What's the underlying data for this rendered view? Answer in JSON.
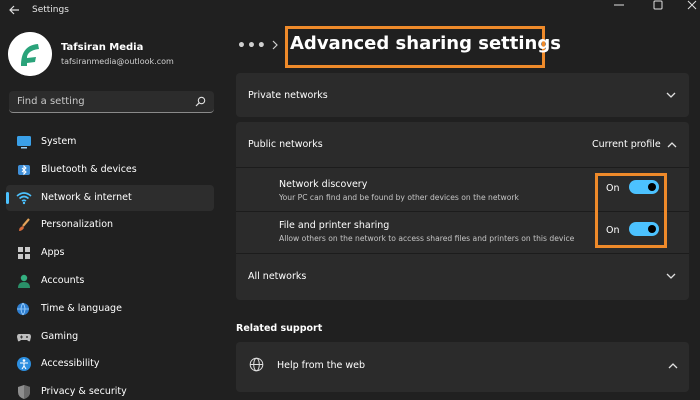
{
  "titlebar": {
    "app_title": "Settings"
  },
  "profile": {
    "name": "Tafsiran Media",
    "email": "tafsiranmedia@outlook.com"
  },
  "search": {
    "placeholder": "Find a setting"
  },
  "sidebar": {
    "items": [
      {
        "label": "System",
        "icon": "monitor-icon",
        "active": false
      },
      {
        "label": "Bluetooth & devices",
        "icon": "bluetooth-icon",
        "active": false
      },
      {
        "label": "Network & internet",
        "icon": "wifi-icon",
        "active": true
      },
      {
        "label": "Personalization",
        "icon": "brush-icon",
        "active": false
      },
      {
        "label": "Apps",
        "icon": "apps-icon",
        "active": false
      },
      {
        "label": "Accounts",
        "icon": "person-icon",
        "active": false
      },
      {
        "label": "Time & language",
        "icon": "globe-clock-icon",
        "active": false
      },
      {
        "label": "Gaming",
        "icon": "gamepad-icon",
        "active": false
      },
      {
        "label": "Accessibility",
        "icon": "accessibility-icon",
        "active": false
      },
      {
        "label": "Privacy & security",
        "icon": "shield-icon",
        "active": false
      }
    ]
  },
  "breadcrumb": {
    "ellipsis": "•••",
    "title": "Advanced sharing settings"
  },
  "sections": {
    "private": {
      "label": "Private networks",
      "expanded": false
    },
    "public": {
      "label": "Public networks",
      "tag": "Current profile",
      "expanded": true,
      "settings": [
        {
          "title": "Network discovery",
          "description": "Your PC can find and be found by other devices on the network",
          "state": "On"
        },
        {
          "title": "File and printer sharing",
          "description": "Allow others on the network to access shared files and printers on this device",
          "state": "On"
        }
      ]
    },
    "all": {
      "label": "All networks",
      "expanded": false
    }
  },
  "related_support": {
    "heading": "Related support",
    "help": {
      "label": "Help from the web",
      "expanded": true
    }
  },
  "colors": {
    "accent": "#4cc2ff",
    "highlight": "#ef8a2a",
    "background": "#202020",
    "card": "#2b2b2b"
  }
}
